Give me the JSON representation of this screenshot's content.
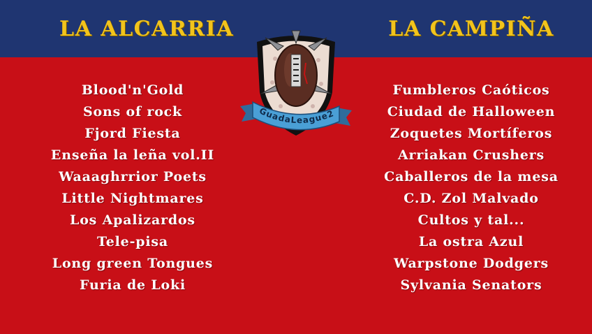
{
  "conferences": {
    "left": {
      "title": "LA ALCARRIA",
      "teams": [
        "Blood'n'Gold",
        "Sons of rock",
        "Fjord Fiesta",
        "Enseña la leña vol.II",
        "Waaaghrrior Poets",
        "Little Nightmares",
        "Los Apalizardos",
        "Tele-pisa",
        "Long green Tongues",
        "Furia de Loki"
      ]
    },
    "right": {
      "title": "LA CAMPIÑA",
      "teams": [
        "Fumbleros Caóticos",
        "Ciudad de Halloween",
        "Zoquetes Mortíferos",
        "Arriakan Crushers",
        "Caballeros de la mesa",
        "C.D. Zol Malvado",
        "Cultos y tal...",
        "La ostra Azul",
        "Warpstone Dodgers",
        "Sylvania Senators"
      ]
    }
  },
  "logo": {
    "banner_text": "GuadaLeague2",
    "icon": "spiked-football-shield-logo"
  },
  "colors": {
    "top_band": "#1f3571",
    "background": "#c80f17",
    "title_text": "#f2c41c",
    "team_text": "#ffffff",
    "banner": "#4a9fd6"
  }
}
